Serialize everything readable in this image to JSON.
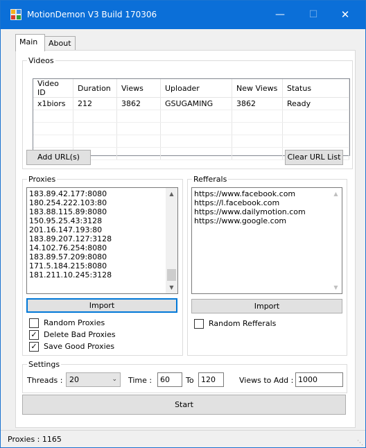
{
  "window": {
    "title": "MotionDemon V3 Build 170306"
  },
  "tabs": [
    {
      "label": "Main"
    },
    {
      "label": "About"
    }
  ],
  "videos": {
    "group_label": "Videos",
    "columns": [
      "Video ID",
      "Duration",
      "Views",
      "Uploader",
      "New Views",
      "Status"
    ],
    "rows": [
      [
        "x1biors",
        "212",
        "3862",
        "GSUGAMING",
        "3862",
        "Ready"
      ]
    ],
    "add_button": "Add URL(s)",
    "clear_button": "Clear URL List"
  },
  "proxies": {
    "group_label": "Proxies",
    "list": [
      "183.89.42.177:8080",
      "180.254.222.103:80",
      "183.88.115.89:8080",
      "150.95.25.43:3128",
      "201.16.147.193:80",
      "183.89.207.127:3128",
      "14.102.76.254:8080",
      "183.89.57.209:8080",
      "171.5.184.215:8080",
      "181.211.10.245:3128"
    ],
    "import_button": "Import",
    "options": [
      {
        "label": "Random Proxies",
        "checked": false
      },
      {
        "label": "Delete Bad Proxies",
        "checked": true
      },
      {
        "label": "Save Good Proxies",
        "checked": true
      }
    ]
  },
  "referrals": {
    "group_label": "Refferals",
    "list": [
      "https://www.facebook.com",
      "https://l.facebook.com",
      "https://www.dailymotion.com",
      "https://www.google.com"
    ],
    "import_button": "Import",
    "random_label": "Random Refferals",
    "random_checked": false
  },
  "settings": {
    "group_label": "Settings",
    "threads_label": "Threads :",
    "threads_value": "20",
    "time_label": "Time :",
    "time_from": "60",
    "to_label": "To",
    "time_to": "120",
    "views_label": "Views to Add :",
    "views_value": "1000"
  },
  "start_button": "Start",
  "status": {
    "proxies_text": "Proxies : 1165"
  },
  "colors": {
    "titlebar": "#0b6fd8",
    "focus": "#0078d7"
  }
}
